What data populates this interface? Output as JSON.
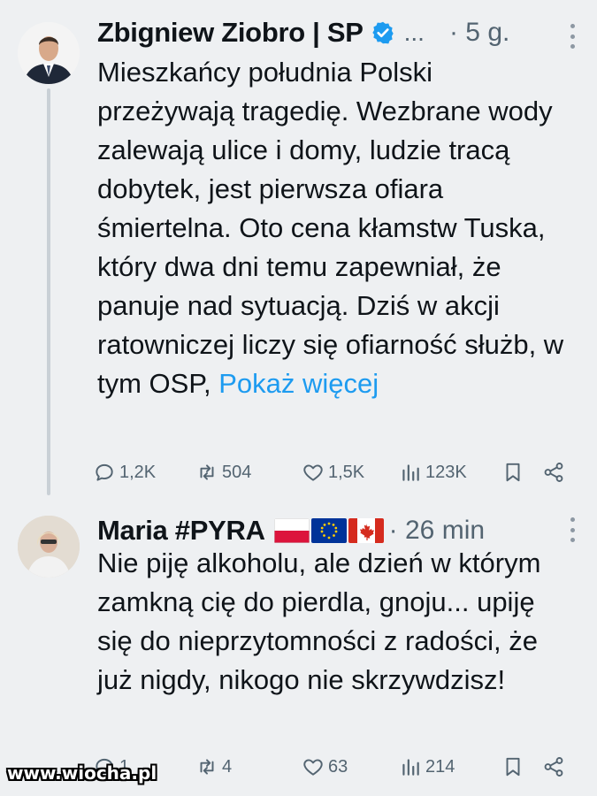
{
  "tweets": [
    {
      "author": "Zbigniew Ziobro | SP",
      "ellipsis": "...",
      "time": "· 5 g.",
      "avatar_icon": "person-suit-avatar",
      "text": "Mieszkańcy południa Polski przeżywają tragedię. Wezbrane wody zalewają ulice i domy, ludzie tracą dobytek, jest pierwsza ofiara śmiertelna. Oto cena kłamstw Tuska, który dwa dni temu zapewniał, że panuje nad sytuacją. Dziś w akcji ratowniczej liczy się ofiarność służb, w tym OSP, ",
      "show_more": "Pokaż więcej",
      "actions": {
        "replies": "1,2K",
        "reposts": "504",
        "likes": "1,5K",
        "views": "123K"
      }
    },
    {
      "author": "Maria #PYRA",
      "time": "· 26 min",
      "avatar_icon": "woman-avatar",
      "flags": [
        "poland-flag",
        "eu-flag",
        "canada-flag"
      ],
      "text": "Nie piję alkoholu, ale dzień w którym zamkną cię do pierdla, gnoju... upiję się do nieprzytomności z radości, że już nigdy, nikogo nie skrzywdzisz!",
      "actions": {
        "replies": "1",
        "reposts": "4",
        "likes": "63",
        "views": "214"
      }
    }
  ],
  "watermark": "www.wiocha.pl",
  "colors": {
    "link": "#1d9bf0",
    "verified": "#1d9bf0",
    "muted": "#536471",
    "background": "#eef0f2"
  }
}
